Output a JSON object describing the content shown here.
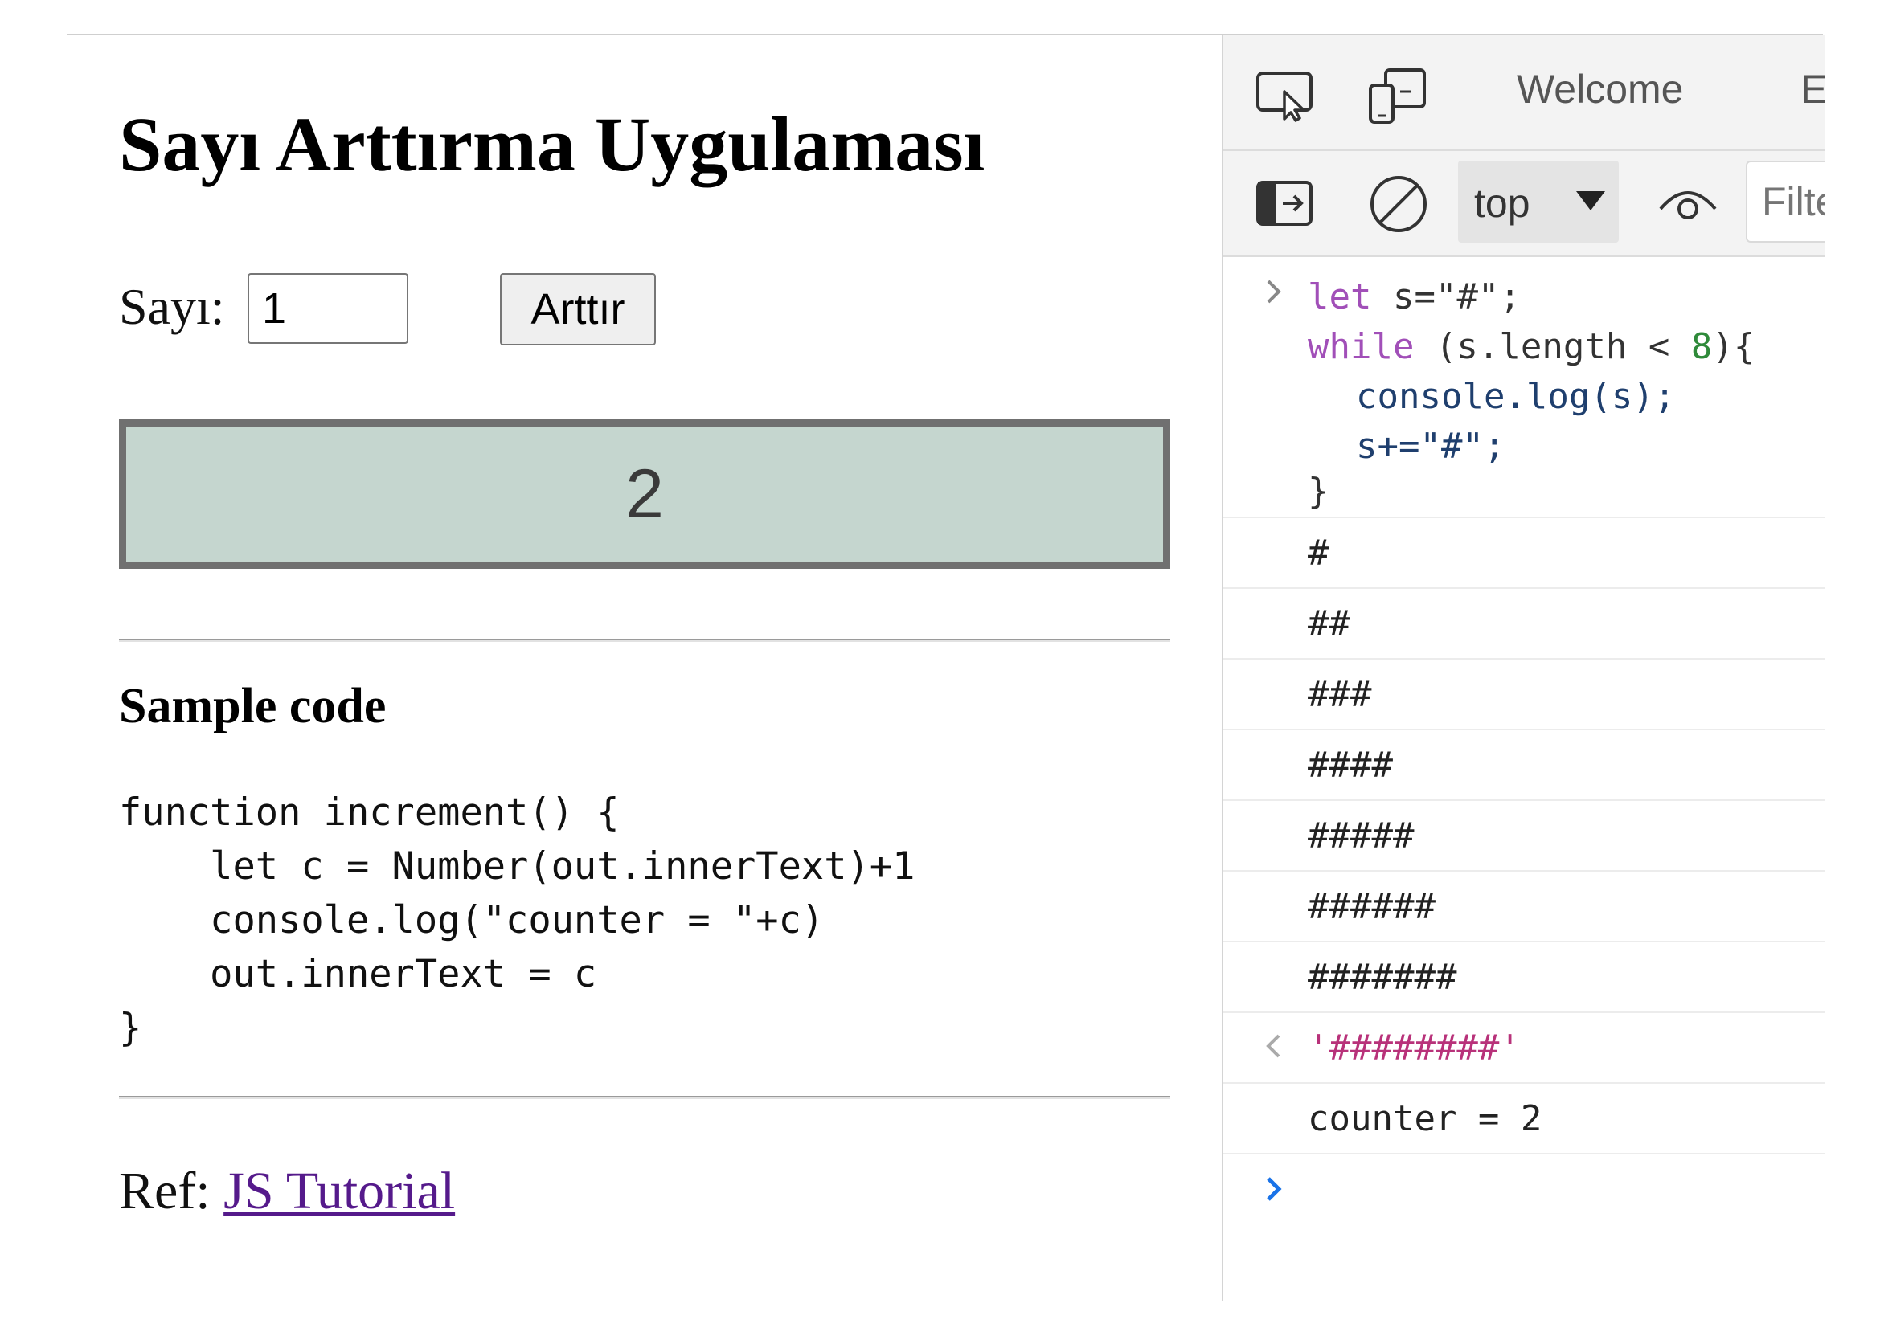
{
  "page": {
    "title": "Sayı Arttırma Uygulaması",
    "form": {
      "label": "Sayı:",
      "input_value": "1",
      "button_label": "Arttır"
    },
    "output_value": "2",
    "sample_title": "Sample code",
    "code_lines": [
      "function increment() {",
      "    let c = Number(out.innerText)+1",
      "    console.log(\"counter = \"+c)",
      "    out.innerText = c",
      "}"
    ],
    "ref": {
      "label": "Ref:",
      "link_text": "JS Tutorial"
    }
  },
  "devtools": {
    "tabs": {
      "welcome": "Welcome",
      "next_partial": "E"
    },
    "toolbar": {
      "context": "top",
      "filter_placeholder": "Filter"
    },
    "console": {
      "input": {
        "line1": {
          "kw": "let",
          "rest": " s=\"#\";"
        },
        "line2": {
          "kw": "while",
          "rest": " (s.length < ",
          "num": "8",
          "end": "){"
        },
        "line3": "console.log(s);",
        "line4": "s+=\"#\";",
        "line5": "}"
      },
      "logs": [
        "#",
        "##",
        "###",
        "####",
        "#####",
        "######",
        "#######"
      ],
      "return_value": "'########'",
      "counter_log": "counter = 2"
    },
    "colors": {
      "keyword": "#a14fb8",
      "string_return": "#b8327a",
      "number": "#2f8a3a",
      "prompt": "#1a73e8"
    }
  }
}
